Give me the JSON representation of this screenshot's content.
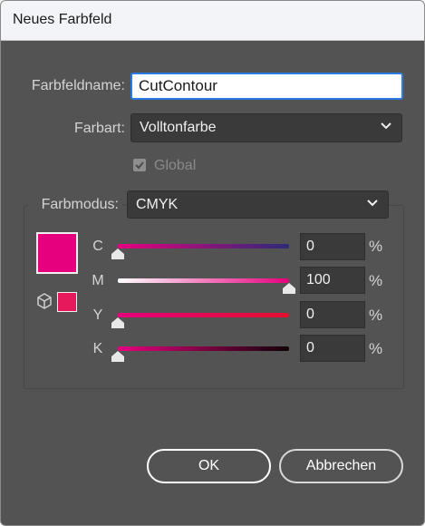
{
  "window": {
    "title": "Neues Farbfeld"
  },
  "swatch_name": {
    "label": "Farbfeldname:",
    "value": "CutContour"
  },
  "color_type": {
    "label": "Farbart:",
    "value": "Volltonfarbe"
  },
  "global": {
    "label": "Global",
    "checked": true,
    "enabled": false
  },
  "color_mode": {
    "label": "Farbmodus:",
    "value": "CMYK"
  },
  "preview": {
    "fill_color": "#e6007e",
    "out_of_gamut_color": "#e6195c"
  },
  "channels": [
    {
      "name": "C",
      "value": "0",
      "unit": "%"
    },
    {
      "name": "M",
      "value": "100",
      "unit": "%"
    },
    {
      "name": "Y",
      "value": "0",
      "unit": "%"
    },
    {
      "name": "K",
      "value": "0",
      "unit": "%"
    }
  ],
  "buttons": {
    "ok": "OK",
    "cancel": "Abbrechen"
  },
  "colors": {
    "panel": "#535353",
    "accent": "#2c7be5",
    "magenta": "#e6007e"
  }
}
